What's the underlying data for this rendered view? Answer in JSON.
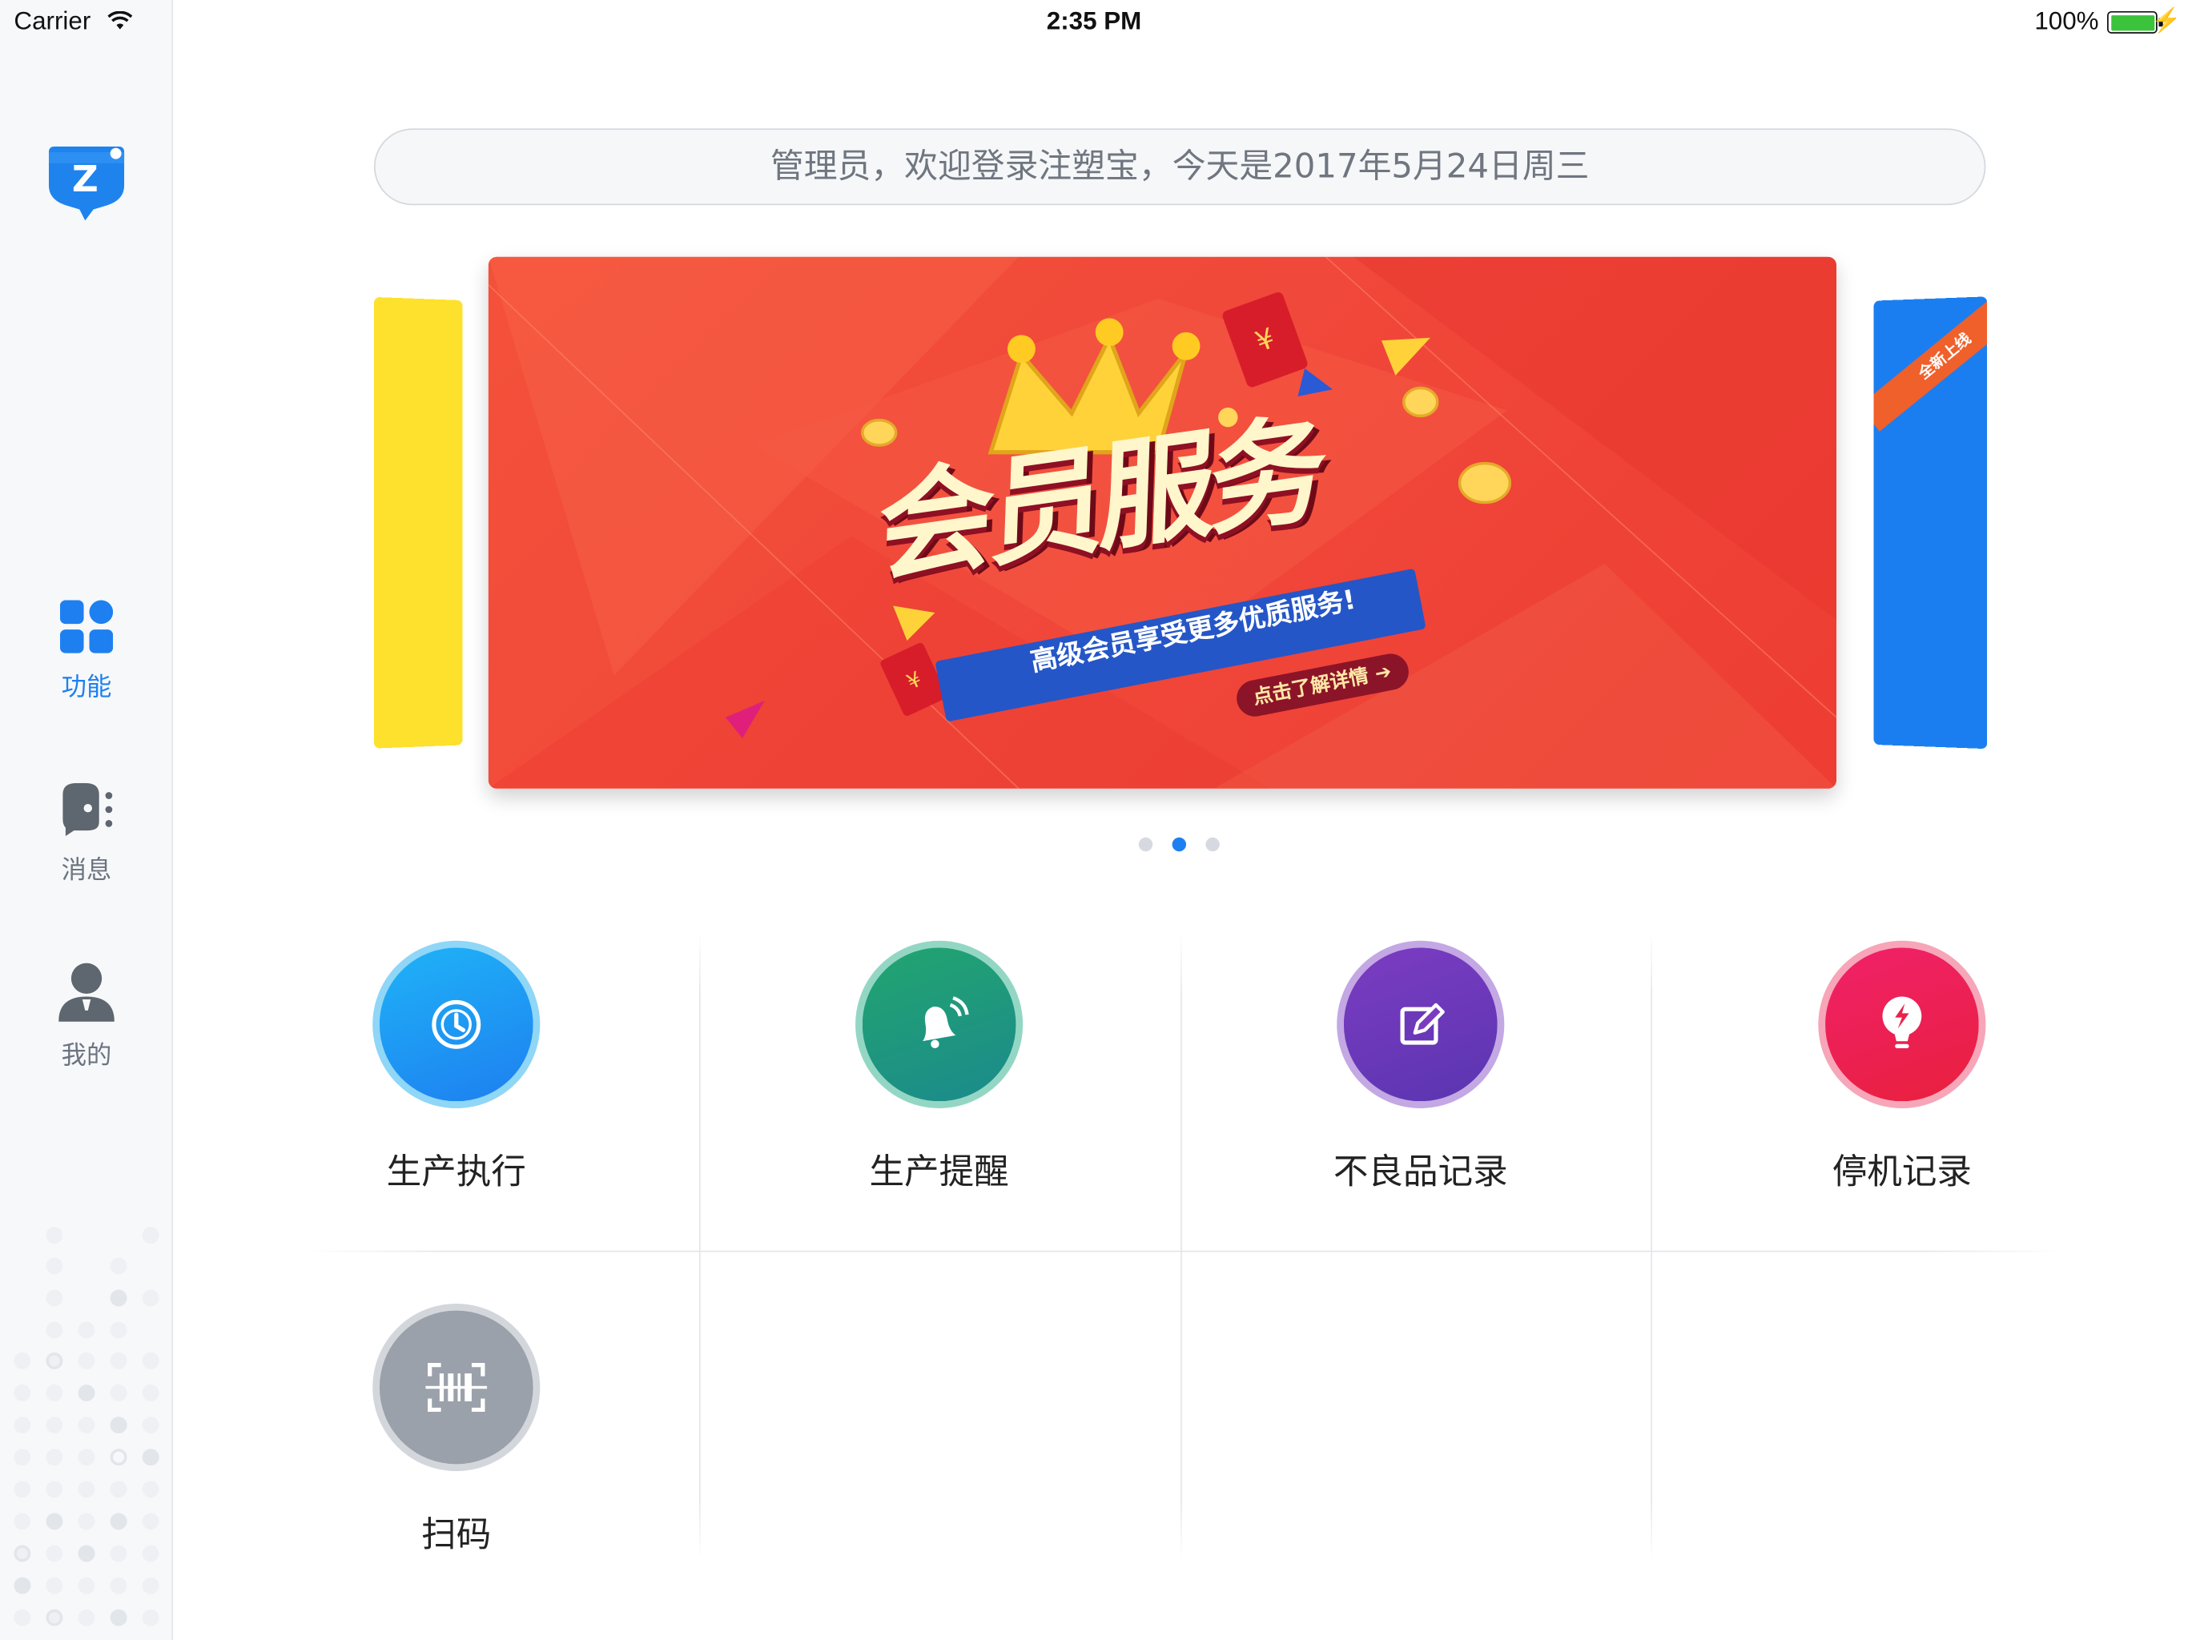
{
  "status_bar": {
    "carrier": "Carrier",
    "time": "2:35 PM",
    "battery": "100%",
    "icons": [
      "wifi-icon",
      "battery-icon",
      "charging-bolt-icon"
    ]
  },
  "sidebar": {
    "logo_letter": "Z",
    "items": [
      {
        "label": "功能",
        "icon": "apps-grid-icon",
        "active": true
      },
      {
        "label": "消息",
        "icon": "message-speaker-icon",
        "active": false
      },
      {
        "label": "我的",
        "icon": "person-icon",
        "active": false
      }
    ]
  },
  "welcome": "管理员，欢迎登录注塑宝，今天是2017年5月24日周三",
  "banner": {
    "title": "会员服务",
    "subtitle": "高级会员享受更多优质服务!",
    "cta": "点击了解详情",
    "side_badge": "全新上线",
    "pages": 3,
    "current_page": 2
  },
  "functions": [
    {
      "label": "生产执行",
      "icon": "clock-icon",
      "color": "#1e90f2",
      "ring": "#8ad3f5"
    },
    {
      "label": "生产提醒",
      "icon": "bell-icon",
      "color": "#1f9a7e",
      "ring": "#8fd3c0"
    },
    {
      "label": "不良品记录",
      "icon": "edit-icon",
      "color": "#6a37b5",
      "ring": "#c0a4e2"
    },
    {
      "label": "停机记录",
      "icon": "bulb-bolt-icon",
      "color": "#ee1b4f",
      "ring": "#f6a2b4"
    },
    {
      "label": "扫码",
      "icon": "barcode-scan-icon",
      "color": "#9aa1aa",
      "ring": "#d2d6db"
    }
  ],
  "colors": {
    "accent": "#1e80f0",
    "banner_red": "#f0483a"
  }
}
